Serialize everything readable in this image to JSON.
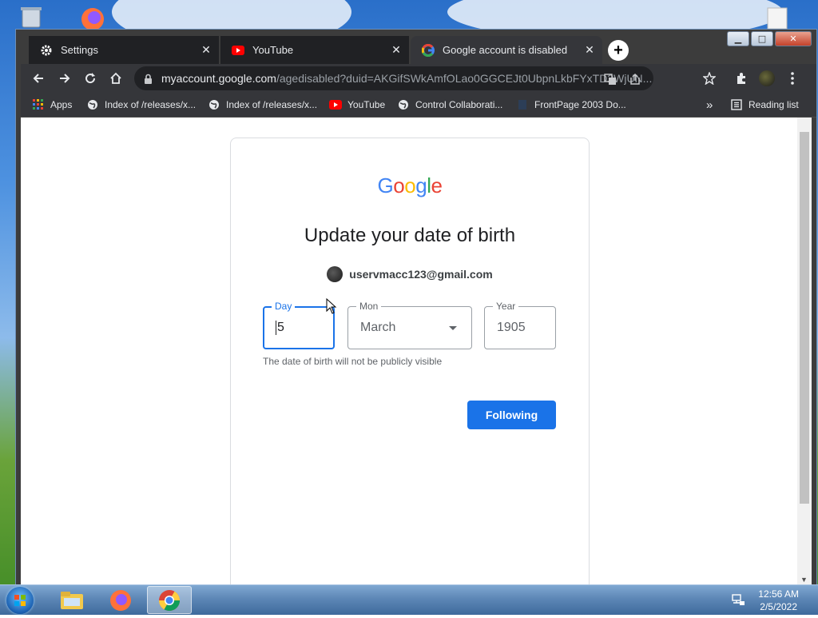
{
  "tabs": [
    {
      "title": "Settings",
      "icon": "gear-icon"
    },
    {
      "title": "YouTube",
      "icon": "youtube-icon"
    },
    {
      "title": "Google account is disabled",
      "icon": "google-icon"
    }
  ],
  "address": {
    "host": "myaccount.google.com",
    "path": "/agedisabled?duid=AKGifSWkAmfOLao0GGCEJt0UbpnLkbFYxTD2WjUN..."
  },
  "bookmarks": [
    {
      "label": "Apps",
      "icon": "apps-grid-icon"
    },
    {
      "label": "Index of /releases/x...",
      "icon": "globe-icon"
    },
    {
      "label": "Index of /releases/x...",
      "icon": "globe-icon"
    },
    {
      "label": "YouTube",
      "icon": "youtube-icon"
    },
    {
      "label": "Control Collaborati...",
      "icon": "globe-icon"
    },
    {
      "label": "FrontPage 2003 Do...",
      "icon": "page-icon"
    }
  ],
  "bookmarks_overflow": "»",
  "reading_list": "Reading list",
  "page": {
    "logo": [
      "G",
      "o",
      "o",
      "g",
      "l",
      "e"
    ],
    "logo_colors": [
      "#4285F4",
      "#EA4335",
      "#FBBC05",
      "#4285F4",
      "#34A853",
      "#EA4335"
    ],
    "heading": "Update your date of birth",
    "email": "uservmacc123@gmail.com",
    "day_label": "Day",
    "day_value": "5",
    "month_label": "Mon",
    "month_value": "March",
    "year_label": "Year",
    "year_value": "1905",
    "hint": "The date of birth will not be publicly visible",
    "next_button": "Following"
  },
  "taskbar": {
    "time": "12:56 AM",
    "date": "2/5/2022"
  },
  "colors": {
    "accent": "#1a73e8",
    "chrome_dark": "#35363a",
    "tab_inactive": "#202124"
  }
}
